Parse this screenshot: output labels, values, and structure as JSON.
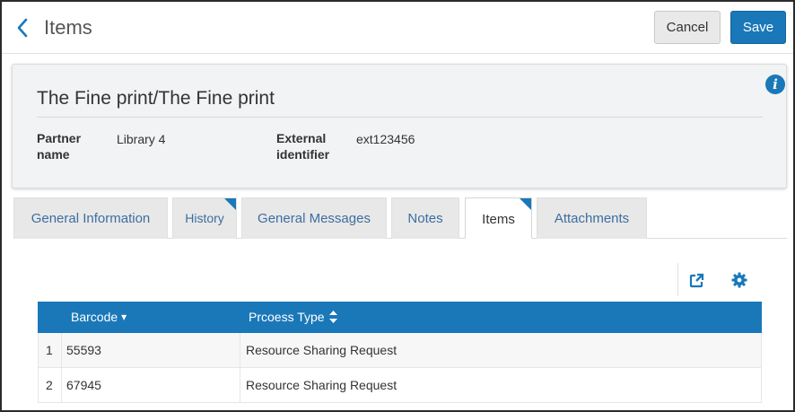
{
  "header": {
    "title": "Items",
    "cancel_label": "Cancel",
    "save_label": "Save"
  },
  "summary": {
    "title": "The Fine print/The Fine print",
    "partner_label_line1": "Partner",
    "partner_label_line2": "name",
    "partner_value": "Library 4",
    "external_label_line1": "External",
    "external_label_line2": "identifier",
    "external_value": "ext123456",
    "info_glyph": "i"
  },
  "tabs": [
    {
      "label": "General Information",
      "active": false,
      "has_indicator": false
    },
    {
      "label": "History",
      "active": false,
      "has_indicator": true
    },
    {
      "label": "General Messages",
      "active": false,
      "has_indicator": false
    },
    {
      "label": "Notes",
      "active": false,
      "has_indicator": false
    },
    {
      "label": "Items",
      "active": true,
      "has_indicator": true
    },
    {
      "label": "Attachments",
      "active": false,
      "has_indicator": false
    }
  ],
  "toolbar": {
    "export_icon": "external-link-icon",
    "settings_icon": "gear-icon"
  },
  "table": {
    "columns": [
      {
        "label": "Barcode",
        "sort": "▾"
      },
      {
        "label": "Prcoess Type",
        "sort": "↕"
      }
    ],
    "rows": [
      {
        "index": "1",
        "barcode": "55593",
        "process_type": "Resource Sharing Request"
      },
      {
        "index": "2",
        "barcode": "67945",
        "process_type": "Resource Sharing Request"
      }
    ]
  },
  "colors": {
    "accent": "#1a78b9",
    "tab_text": "#3c6ea0"
  }
}
